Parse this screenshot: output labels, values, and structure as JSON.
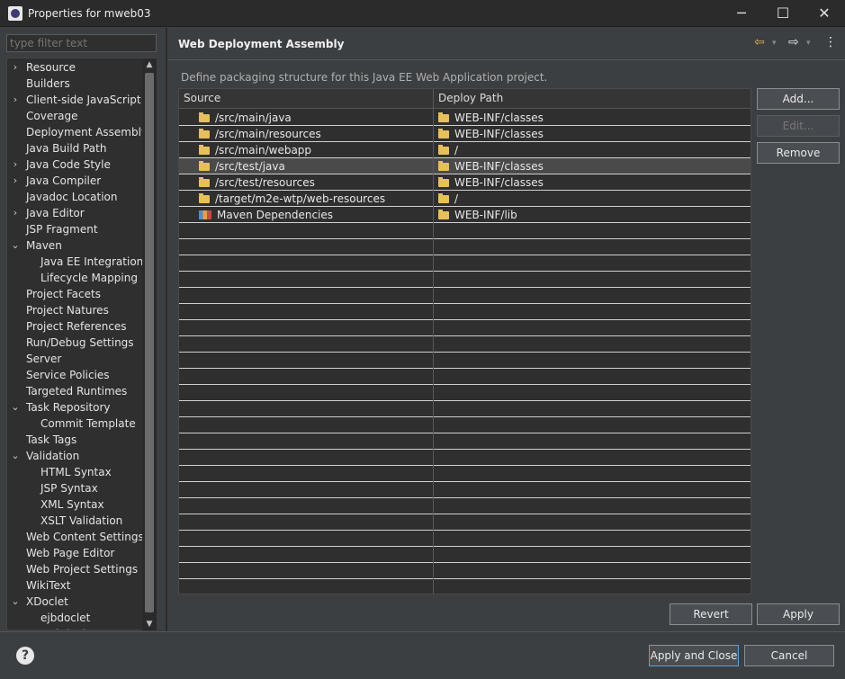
{
  "window": {
    "title": "Properties for mweb03",
    "minimize_glyph": "─",
    "maximize_glyph": "☐",
    "close_glyph": "✕"
  },
  "filter": {
    "placeholder": "type filter text"
  },
  "tree": [
    {
      "label": "Resource",
      "indent": 0,
      "arrow": "›"
    },
    {
      "label": "Builders",
      "indent": 0,
      "arrow": ""
    },
    {
      "label": "Client-side JavaScript",
      "indent": 0,
      "arrow": "›"
    },
    {
      "label": "Coverage",
      "indent": 0,
      "arrow": ""
    },
    {
      "label": "Deployment Assembly",
      "indent": 0,
      "arrow": ""
    },
    {
      "label": "Java Build Path",
      "indent": 0,
      "arrow": ""
    },
    {
      "label": "Java Code Style",
      "indent": 0,
      "arrow": "›"
    },
    {
      "label": "Java Compiler",
      "indent": 0,
      "arrow": "›"
    },
    {
      "label": "Javadoc Location",
      "indent": 0,
      "arrow": ""
    },
    {
      "label": "Java Editor",
      "indent": 0,
      "arrow": "›"
    },
    {
      "label": "JSP Fragment",
      "indent": 0,
      "arrow": ""
    },
    {
      "label": "Maven",
      "indent": 0,
      "arrow": "⌄"
    },
    {
      "label": "Java EE Integration",
      "indent": 1,
      "arrow": ""
    },
    {
      "label": "Lifecycle Mapping",
      "indent": 1,
      "arrow": ""
    },
    {
      "label": "Project Facets",
      "indent": 0,
      "arrow": ""
    },
    {
      "label": "Project Natures",
      "indent": 0,
      "arrow": ""
    },
    {
      "label": "Project References",
      "indent": 0,
      "arrow": ""
    },
    {
      "label": "Run/Debug Settings",
      "indent": 0,
      "arrow": ""
    },
    {
      "label": "Server",
      "indent": 0,
      "arrow": ""
    },
    {
      "label": "Service Policies",
      "indent": 0,
      "arrow": ""
    },
    {
      "label": "Targeted Runtimes",
      "indent": 0,
      "arrow": ""
    },
    {
      "label": "Task Repository",
      "indent": 0,
      "arrow": "⌄"
    },
    {
      "label": "Commit Template",
      "indent": 1,
      "arrow": ""
    },
    {
      "label": "Task Tags",
      "indent": 0,
      "arrow": ""
    },
    {
      "label": "Validation",
      "indent": 0,
      "arrow": "⌄"
    },
    {
      "label": "HTML Syntax",
      "indent": 1,
      "arrow": ""
    },
    {
      "label": "JSP Syntax",
      "indent": 1,
      "arrow": ""
    },
    {
      "label": "XML Syntax",
      "indent": 1,
      "arrow": ""
    },
    {
      "label": "XSLT Validation",
      "indent": 1,
      "arrow": ""
    },
    {
      "label": "Web Content Settings",
      "indent": 0,
      "arrow": ""
    },
    {
      "label": "Web Page Editor",
      "indent": 0,
      "arrow": ""
    },
    {
      "label": "Web Project Settings",
      "indent": 0,
      "arrow": ""
    },
    {
      "label": "WikiText",
      "indent": 0,
      "arrow": ""
    },
    {
      "label": "XDoclet",
      "indent": 0,
      "arrow": "⌄"
    },
    {
      "label": "ejbdoclet",
      "indent": 1,
      "arrow": ""
    },
    {
      "label": "webdoclet",
      "indent": 1,
      "arrow": ""
    }
  ],
  "scroll": {
    "up_glyph": "▲",
    "down_glyph": "▼"
  },
  "page": {
    "title": "Web Deployment Assembly",
    "description": "Define packaging structure for this Java EE Web Application project.",
    "nav_back_glyph": "⇦",
    "nav_fwd_glyph": "⇨",
    "menu_glyph": "⋮"
  },
  "table": {
    "col_source": "Source",
    "col_deploy": "Deploy Path",
    "sort_glyph": "^",
    "rows": [
      {
        "source": "/src/main/java",
        "deploy": "WEB-INF/classes",
        "icon": "folder-icon"
      },
      {
        "source": "/src/main/resources",
        "deploy": "WEB-INF/classes",
        "icon": "folder-icon"
      },
      {
        "source": "/src/main/webapp",
        "deploy": "/",
        "icon": "folder-icon"
      },
      {
        "source": "/src/test/java",
        "deploy": "WEB-INF/classes",
        "icon": "folder-icon",
        "selected": true
      },
      {
        "source": "/src/test/resources",
        "deploy": "WEB-INF/classes",
        "icon": "folder-icon"
      },
      {
        "source": "/target/m2e-wtp/web-resources",
        "deploy": "/",
        "icon": "folder-icon"
      },
      {
        "source": "Maven Dependencies",
        "deploy": "WEB-INF/lib",
        "icon": "library-icon"
      }
    ]
  },
  "buttons": {
    "add": "Add...",
    "edit": "Edit...",
    "remove": "Remove",
    "revert": "Revert",
    "apply": "Apply",
    "apply_close": "Apply and Close",
    "cancel": "Cancel",
    "help_glyph": "?"
  },
  "colors": {
    "background": "#3b3f42",
    "table_bg": "#2f2f2f",
    "selected_row": "#4a4a4a",
    "folder": "#e8c05a",
    "default_button_border": "#5aa0e0"
  }
}
